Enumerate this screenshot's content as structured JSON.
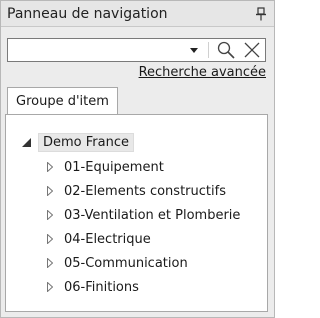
{
  "panel": {
    "title": "Panneau de navigation",
    "search": {
      "value": "",
      "placeholder": ""
    },
    "advanced_search_label": "Recherche avancée",
    "tabs": [
      {
        "label": "Groupe d'item"
      }
    ],
    "tree": {
      "root": {
        "label": "Demo France",
        "expanded": true
      },
      "children": [
        {
          "label": "01-Equipement"
        },
        {
          "label": "02-Elements constructifs"
        },
        {
          "label": "03-Ventilation et Plomberie"
        },
        {
          "label": "04-Electrique"
        },
        {
          "label": "05-Communication"
        },
        {
          "label": "06-Finitions"
        }
      ]
    }
  },
  "icons": {
    "pin": "pin-icon",
    "dropdown": "dropdown-arrow-icon",
    "search": "search-icon",
    "clear": "close-icon",
    "expanded": "expanded-triangle-icon",
    "collapsed": "collapsed-triangle-icon"
  },
  "colors": {
    "panel_bg": "#ececec",
    "content_bg": "#ffffff",
    "border": "#a8a8a8",
    "selected_bg": "#e8e8e8"
  }
}
